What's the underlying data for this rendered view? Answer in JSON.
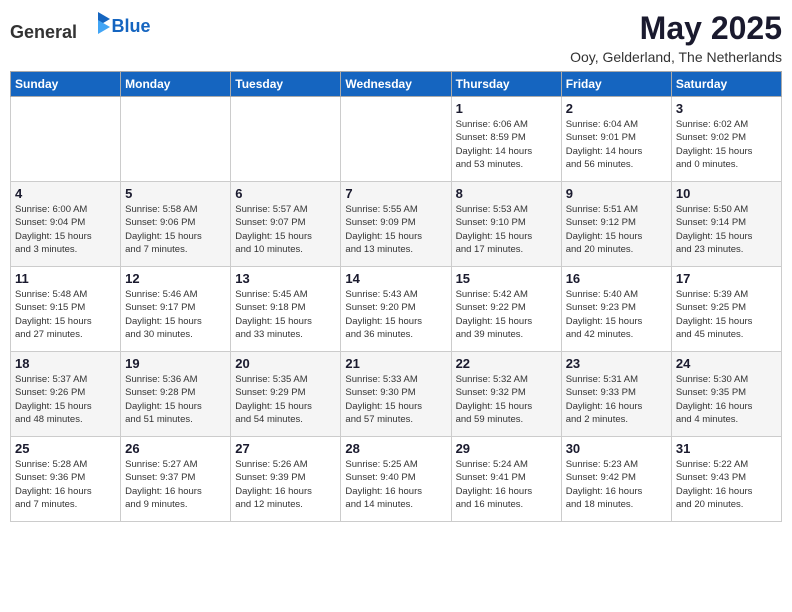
{
  "header": {
    "logo_general": "General",
    "logo_blue": "Blue",
    "month_year": "May 2025",
    "location": "Ooy, Gelderland, The Netherlands"
  },
  "weekdays": [
    "Sunday",
    "Monday",
    "Tuesday",
    "Wednesday",
    "Thursday",
    "Friday",
    "Saturday"
  ],
  "weeks": [
    [
      {
        "day": "",
        "detail": ""
      },
      {
        "day": "",
        "detail": ""
      },
      {
        "day": "",
        "detail": ""
      },
      {
        "day": "",
        "detail": ""
      },
      {
        "day": "1",
        "detail": "Sunrise: 6:06 AM\nSunset: 8:59 PM\nDaylight: 14 hours\nand 53 minutes."
      },
      {
        "day": "2",
        "detail": "Sunrise: 6:04 AM\nSunset: 9:01 PM\nDaylight: 14 hours\nand 56 minutes."
      },
      {
        "day": "3",
        "detail": "Sunrise: 6:02 AM\nSunset: 9:02 PM\nDaylight: 15 hours\nand 0 minutes."
      }
    ],
    [
      {
        "day": "4",
        "detail": "Sunrise: 6:00 AM\nSunset: 9:04 PM\nDaylight: 15 hours\nand 3 minutes."
      },
      {
        "day": "5",
        "detail": "Sunrise: 5:58 AM\nSunset: 9:06 PM\nDaylight: 15 hours\nand 7 minutes."
      },
      {
        "day": "6",
        "detail": "Sunrise: 5:57 AM\nSunset: 9:07 PM\nDaylight: 15 hours\nand 10 minutes."
      },
      {
        "day": "7",
        "detail": "Sunrise: 5:55 AM\nSunset: 9:09 PM\nDaylight: 15 hours\nand 13 minutes."
      },
      {
        "day": "8",
        "detail": "Sunrise: 5:53 AM\nSunset: 9:10 PM\nDaylight: 15 hours\nand 17 minutes."
      },
      {
        "day": "9",
        "detail": "Sunrise: 5:51 AM\nSunset: 9:12 PM\nDaylight: 15 hours\nand 20 minutes."
      },
      {
        "day": "10",
        "detail": "Sunrise: 5:50 AM\nSunset: 9:14 PM\nDaylight: 15 hours\nand 23 minutes."
      }
    ],
    [
      {
        "day": "11",
        "detail": "Sunrise: 5:48 AM\nSunset: 9:15 PM\nDaylight: 15 hours\nand 27 minutes."
      },
      {
        "day": "12",
        "detail": "Sunrise: 5:46 AM\nSunset: 9:17 PM\nDaylight: 15 hours\nand 30 minutes."
      },
      {
        "day": "13",
        "detail": "Sunrise: 5:45 AM\nSunset: 9:18 PM\nDaylight: 15 hours\nand 33 minutes."
      },
      {
        "day": "14",
        "detail": "Sunrise: 5:43 AM\nSunset: 9:20 PM\nDaylight: 15 hours\nand 36 minutes."
      },
      {
        "day": "15",
        "detail": "Sunrise: 5:42 AM\nSunset: 9:22 PM\nDaylight: 15 hours\nand 39 minutes."
      },
      {
        "day": "16",
        "detail": "Sunrise: 5:40 AM\nSunset: 9:23 PM\nDaylight: 15 hours\nand 42 minutes."
      },
      {
        "day": "17",
        "detail": "Sunrise: 5:39 AM\nSunset: 9:25 PM\nDaylight: 15 hours\nand 45 minutes."
      }
    ],
    [
      {
        "day": "18",
        "detail": "Sunrise: 5:37 AM\nSunset: 9:26 PM\nDaylight: 15 hours\nand 48 minutes."
      },
      {
        "day": "19",
        "detail": "Sunrise: 5:36 AM\nSunset: 9:28 PM\nDaylight: 15 hours\nand 51 minutes."
      },
      {
        "day": "20",
        "detail": "Sunrise: 5:35 AM\nSunset: 9:29 PM\nDaylight: 15 hours\nand 54 minutes."
      },
      {
        "day": "21",
        "detail": "Sunrise: 5:33 AM\nSunset: 9:30 PM\nDaylight: 15 hours\nand 57 minutes."
      },
      {
        "day": "22",
        "detail": "Sunrise: 5:32 AM\nSunset: 9:32 PM\nDaylight: 15 hours\nand 59 minutes."
      },
      {
        "day": "23",
        "detail": "Sunrise: 5:31 AM\nSunset: 9:33 PM\nDaylight: 16 hours\nand 2 minutes."
      },
      {
        "day": "24",
        "detail": "Sunrise: 5:30 AM\nSunset: 9:35 PM\nDaylight: 16 hours\nand 4 minutes."
      }
    ],
    [
      {
        "day": "25",
        "detail": "Sunrise: 5:28 AM\nSunset: 9:36 PM\nDaylight: 16 hours\nand 7 minutes."
      },
      {
        "day": "26",
        "detail": "Sunrise: 5:27 AM\nSunset: 9:37 PM\nDaylight: 16 hours\nand 9 minutes."
      },
      {
        "day": "27",
        "detail": "Sunrise: 5:26 AM\nSunset: 9:39 PM\nDaylight: 16 hours\nand 12 minutes."
      },
      {
        "day": "28",
        "detail": "Sunrise: 5:25 AM\nSunset: 9:40 PM\nDaylight: 16 hours\nand 14 minutes."
      },
      {
        "day": "29",
        "detail": "Sunrise: 5:24 AM\nSunset: 9:41 PM\nDaylight: 16 hours\nand 16 minutes."
      },
      {
        "day": "30",
        "detail": "Sunrise: 5:23 AM\nSunset: 9:42 PM\nDaylight: 16 hours\nand 18 minutes."
      },
      {
        "day": "31",
        "detail": "Sunrise: 5:22 AM\nSunset: 9:43 PM\nDaylight: 16 hours\nand 20 minutes."
      }
    ]
  ]
}
